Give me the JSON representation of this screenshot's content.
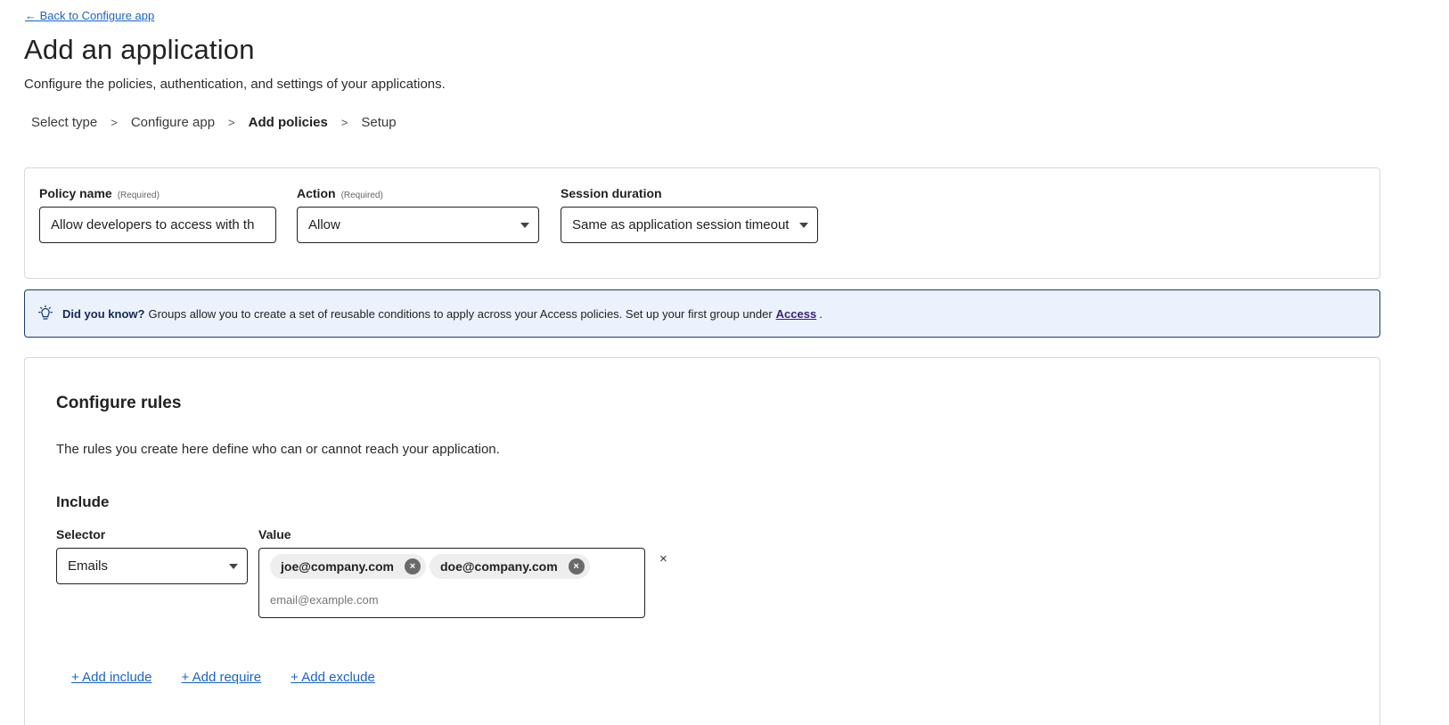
{
  "header": {
    "back_link": "← Back to Configure app",
    "title": "Add an application",
    "subtitle": "Configure the policies, authentication, and settings of your applications."
  },
  "steps": [
    {
      "label": "Select type"
    },
    {
      "label": "Configure app"
    },
    {
      "label": "Add policies",
      "active": true
    },
    {
      "label": "Setup"
    }
  ],
  "step_separator": ">",
  "policy": {
    "name_label": "Policy name",
    "name_required": "(Required)",
    "name_value": "Allow developers to access with th",
    "action_label": "Action",
    "action_required": "(Required)",
    "action_value": "Allow",
    "session_label": "Session duration",
    "session_value": "Same as application session timeout"
  },
  "callout": {
    "icon": "lightbulb-icon",
    "lead": "Did you know?",
    "text": "Groups allow you to create a set of reusable conditions to apply across your Access policies. Set up your first group under",
    "link": "Access",
    "trail": "."
  },
  "rules": {
    "title": "Configure rules",
    "description": "The rules you create here define who can or cannot reach your application.",
    "include_title": "Include",
    "selector_label": "Selector",
    "selector_value": "Emails",
    "value_label": "Value",
    "chips": [
      "joe@company.com",
      "doe@company.com"
    ],
    "chip_remove_glyph": "×",
    "value_placeholder": "email@example.com",
    "remove_row_glyph": "×",
    "add_links": [
      "+ Add include",
      "+ Add require",
      "+ Add exclude"
    ]
  },
  "colors": {
    "link": "#1a64c8",
    "callout_bg": "#ebf2fd",
    "callout_border": "#1b3b6f"
  }
}
